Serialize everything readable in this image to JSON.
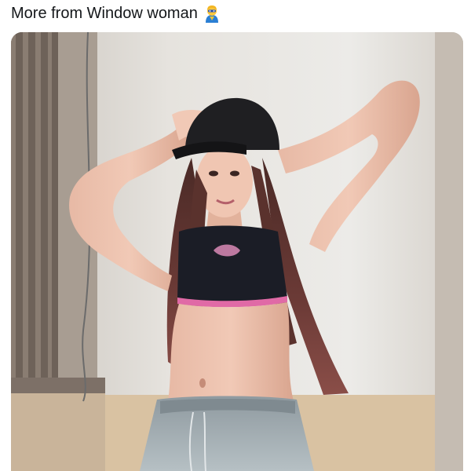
{
  "tweet": {
    "text": "More from Window woman",
    "emoji_icon": "superhero-woman-emoji-icon"
  },
  "media": {
    "type": "photo",
    "subject": "woman in black cap and crop top posing by window"
  },
  "colors": {
    "text": "#14171a",
    "background": "#ffffff"
  }
}
